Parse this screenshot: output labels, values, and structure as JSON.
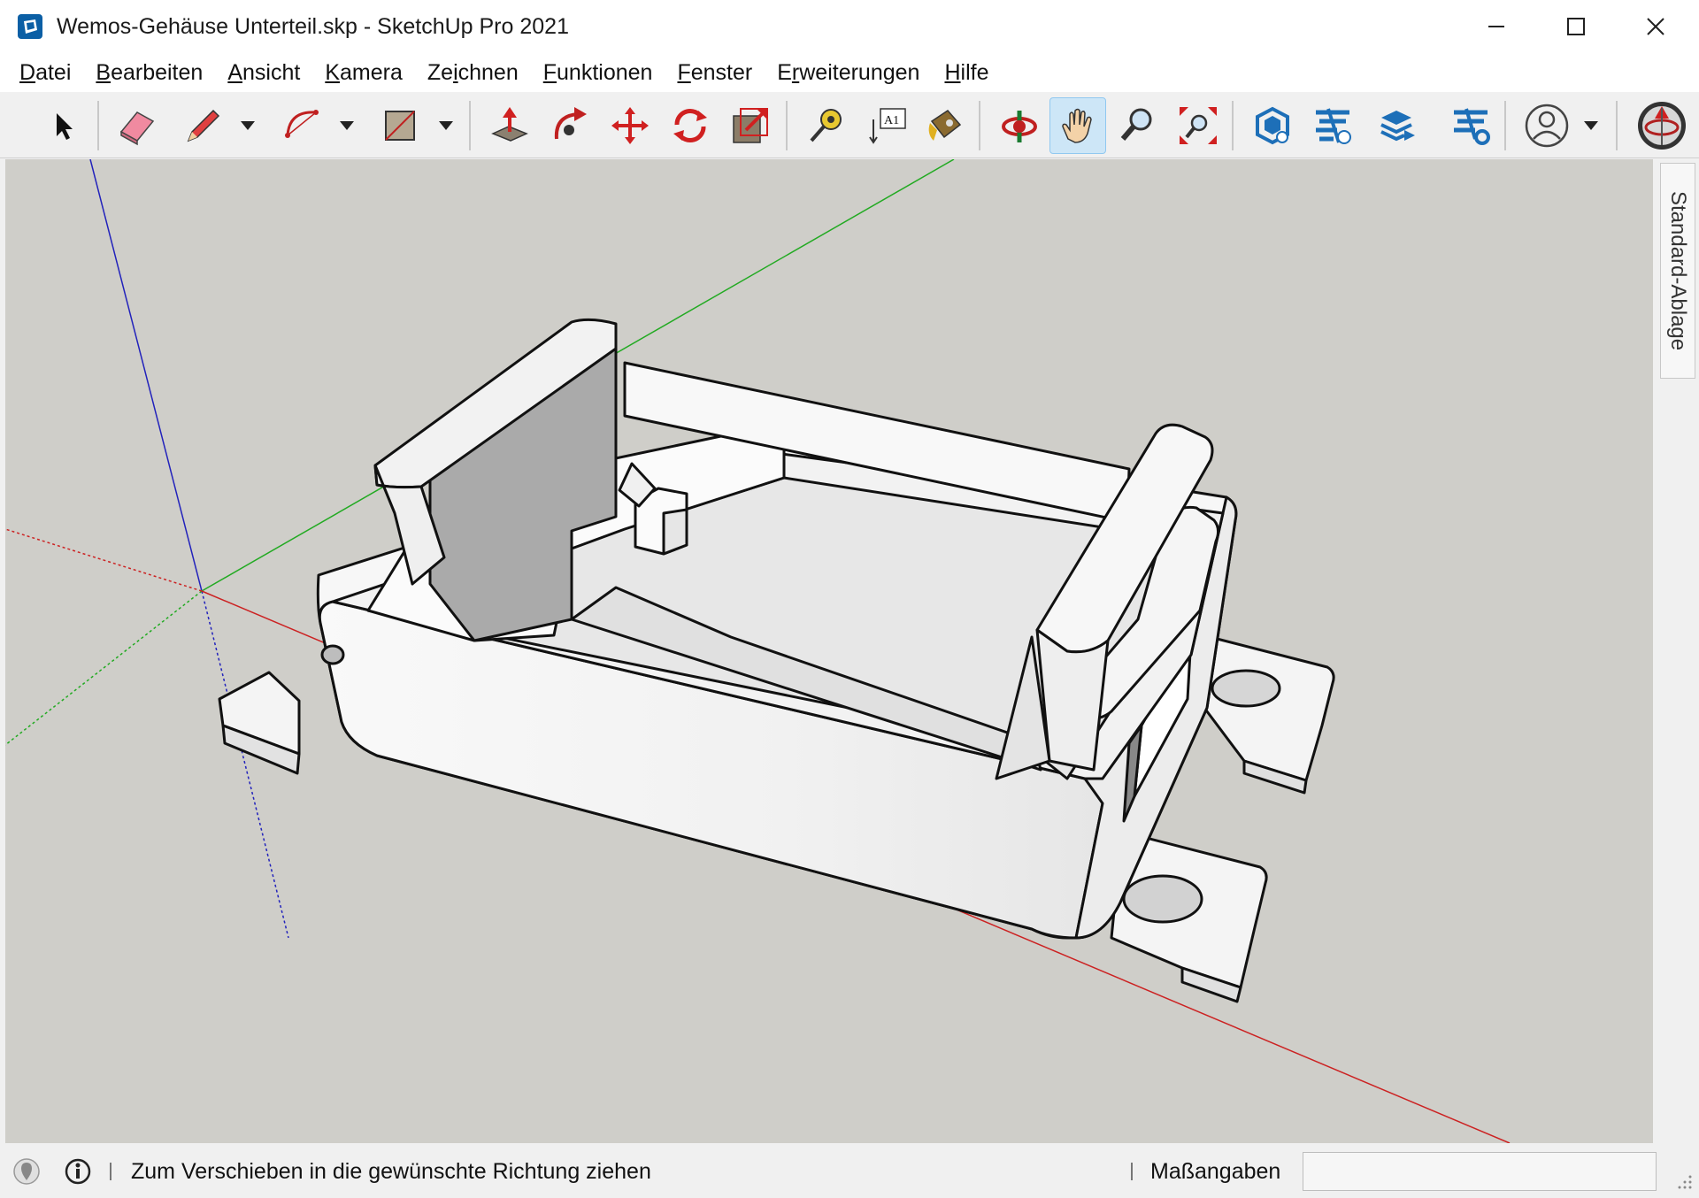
{
  "window": {
    "title": "Wemos-Gehäuse Unterteil.skp - SketchUp Pro 2021",
    "controls": [
      "minimize",
      "maximize",
      "close"
    ]
  },
  "menu": [
    {
      "label": "Datei",
      "accel": "D"
    },
    {
      "label": "Bearbeiten",
      "accel": "B"
    },
    {
      "label": "Ansicht",
      "accel": "A"
    },
    {
      "label": "Kamera",
      "accel": "K"
    },
    {
      "label": "Zeichnen",
      "accel": "i"
    },
    {
      "label": "Funktionen",
      "accel": "F"
    },
    {
      "label": "Fenster",
      "accel": "F"
    },
    {
      "label": "Erweiterungen",
      "accel": "r"
    },
    {
      "label": "Hilfe",
      "accel": "H"
    }
  ],
  "toolbar": {
    "tools": [
      "select-icon",
      "eraser-icon",
      "pencil-icon",
      "arc-icon",
      "rectangle-icon",
      "push-pull-icon",
      "follow-me-icon",
      "move-icon",
      "rotate-icon",
      "scale-icon",
      "tape-measure-icon",
      "text-icon",
      "paint-bucket-icon",
      "orbit-icon",
      "pan-icon",
      "zoom-icon",
      "zoom-extents-icon",
      "3d-warehouse-icon",
      "extension-warehouse-icon",
      "layout-icon",
      "extension-manager-icon",
      "account-icon",
      "trimble-connect-icon"
    ],
    "active_tool": "pan-icon",
    "text_tool_glyph": "A1"
  },
  "tray": {
    "tab_label": "Standard-Ablage"
  },
  "statusbar": {
    "message": "Zum Verschieben in die gewünschte Richtung ziehen",
    "measurements_label": "Maßangaben",
    "measurements_value": ""
  },
  "colors": {
    "viewport_bg": "#cfcec9",
    "axis_red": "#cc2222",
    "axis_green": "#22aa22",
    "axis_blue": "#2222bb",
    "model_face": "#f2f2f2",
    "model_shadow": "#b4b4b4",
    "active_tool_bg": "#cde6f7"
  }
}
